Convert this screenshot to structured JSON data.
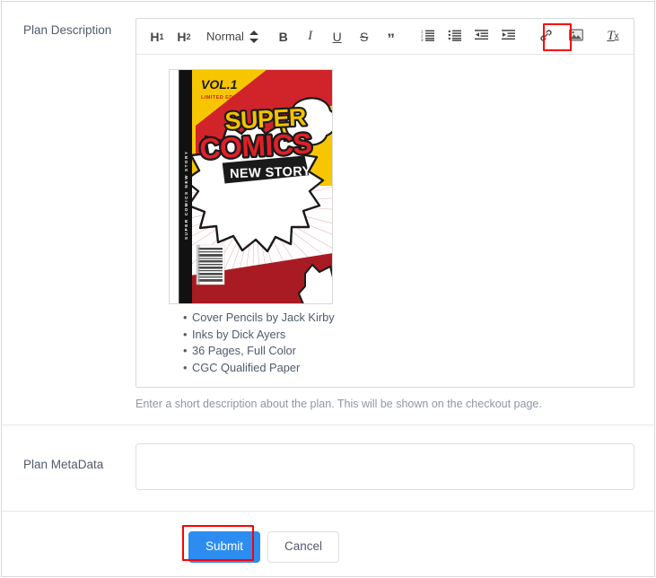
{
  "form": {
    "rows": [
      {
        "label": "Plan Description"
      },
      {
        "label": "Plan MetaData"
      }
    ],
    "description": {
      "label": "Plan Description",
      "help_text": "Enter a short description about the plan. This will be shown on the checkout page.",
      "bullets": [
        "Cover Pencils by Jack Kirby",
        "Inks by Dick Ayers",
        "36 Pages, Full Color",
        "CGC Qualified Paper"
      ]
    },
    "metadata": {
      "label": "Plan MetaData",
      "value": "",
      "placeholder": ""
    }
  },
  "toolbar": {
    "h1_label": "H",
    "h1_sub": "1",
    "h2_label": "H",
    "h2_sub": "2",
    "format_select": "Normal",
    "bold_label": "B",
    "italic_label": "I",
    "underline_label": "U",
    "strike_label": "S",
    "blockquote_label": "”",
    "clear_label": "T",
    "clear_sub": "x",
    "icons": {
      "ordered_list": "ordered-list-icon",
      "bullet_list": "bullet-list-icon",
      "outdent": "outdent-icon",
      "indent": "indent-icon",
      "link": "link-icon",
      "image": "image-icon",
      "clear_format": "clear-format-icon",
      "stepper": "stepper-arrows-icon"
    }
  },
  "comic_cover": {
    "volume": "VOL.1",
    "edition": "LIMITED EDITION",
    "title_line1": "SUPER",
    "title_line2": "COMICS",
    "title_line3": "NEW STORY",
    "spine_text": "SUPER COMICS NEW STORY",
    "colors": {
      "yellow": "#f7c600",
      "red": "#d1232a",
      "dark_red": "#a81b22",
      "title_yellow": "#f2c200",
      "title_red": "#e02028",
      "black": "#1a1a1a",
      "white": "#ffffff"
    }
  },
  "footer": {
    "submit_label": "Submit",
    "cancel_label": "Cancel"
  },
  "highlights": {
    "image_button": "#ff0000",
    "submit_button": "#ff0000"
  },
  "colors": {
    "accent": "#2d8cf0",
    "highlight": "#ff0000",
    "text": "#4f5b6b",
    "muted": "#8d97a3",
    "border": "#d9d9d9"
  }
}
